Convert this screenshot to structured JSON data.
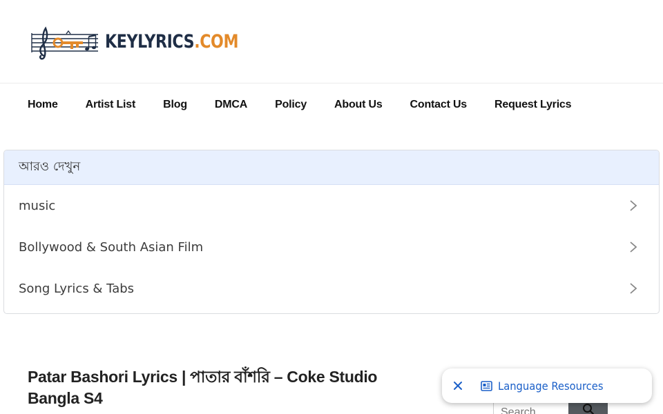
{
  "header": {
    "logo_text_main": "KEYLYRICS",
    "logo_text_suffix": ".COM",
    "logo_icon": "music-staff-key-icon"
  },
  "nav": {
    "items": [
      {
        "label": "Home"
      },
      {
        "label": "Artist List"
      },
      {
        "label": "Blog"
      },
      {
        "label": "DMCA"
      },
      {
        "label": "Policy"
      },
      {
        "label": "About Us"
      },
      {
        "label": "Contact Us"
      },
      {
        "label": "Request Lyrics"
      }
    ]
  },
  "see_more": {
    "title": "আরও দেখুন",
    "items": [
      {
        "label": "music"
      },
      {
        "label": "Bollywood & South Asian Film"
      },
      {
        "label": "Song Lyrics & Tabs"
      }
    ]
  },
  "article": {
    "title": "Patar Bashori Lyrics | পাতার বাঁশরি – Coke Studio Bangla S4"
  },
  "sidebar": {
    "search_placeholder": "Search ..."
  },
  "language_popup": {
    "label": "Language Resources",
    "close_icon": "close-icon",
    "resource_icon": "newspaper-icon"
  },
  "colors": {
    "logo_dark": "#1f2e46",
    "logo_accent": "#e38a2a",
    "see_more_header_bg": "#e8f0fe",
    "link_blue": "#1a5fc8",
    "search_button": "#555a5f"
  }
}
